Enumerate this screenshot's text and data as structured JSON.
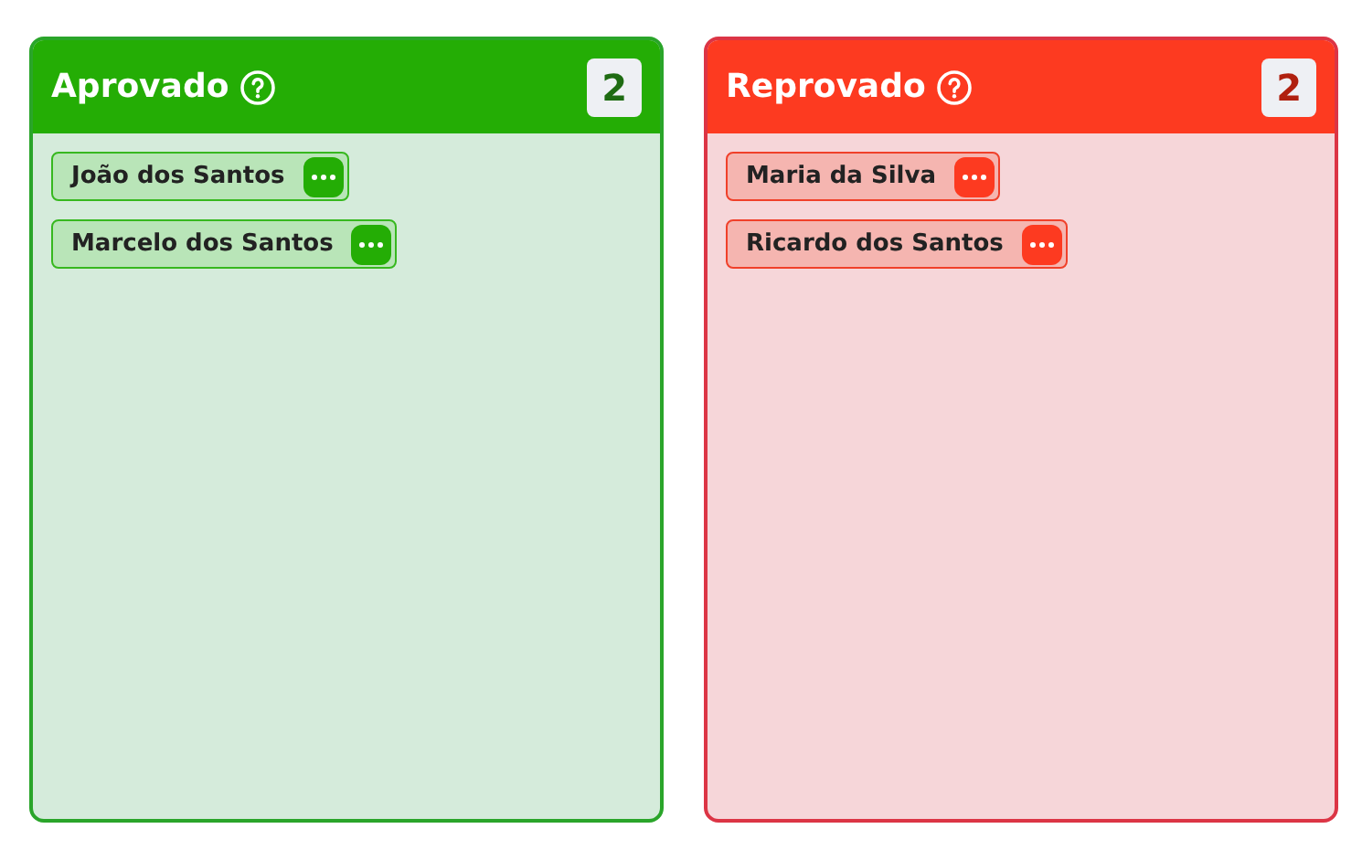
{
  "columns": [
    {
      "kind": "approved",
      "title": "Aprovado",
      "count": "2",
      "cards": [
        {
          "name": "João dos Santos"
        },
        {
          "name": "Marcelo dos Santos"
        }
      ]
    },
    {
      "kind": "rejected",
      "title": "Reprovado",
      "count": "2",
      "cards": [
        {
          "name": "Maria da Silva"
        },
        {
          "name": "Ricardo dos Santos"
        }
      ]
    }
  ]
}
